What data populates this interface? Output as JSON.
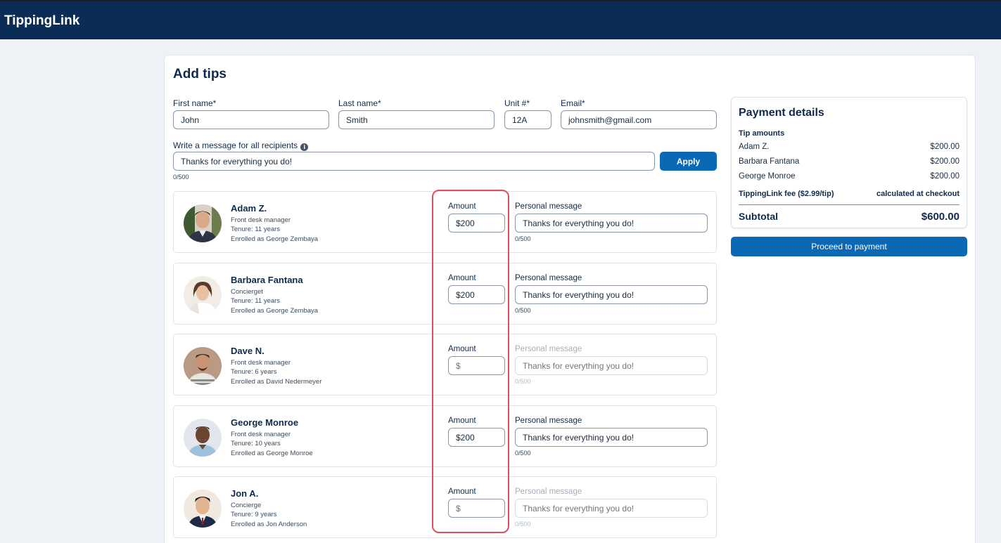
{
  "app": {
    "title": "TippingLink"
  },
  "page": {
    "title": "Add tips"
  },
  "form": {
    "first_name": {
      "label": "First name*",
      "value": "John"
    },
    "last_name": {
      "label": "Last name*",
      "value": "Smith"
    },
    "unit": {
      "label": "Unit #*",
      "value": "12A"
    },
    "email": {
      "label": "Email*",
      "value": "johnsmith@gmail.com"
    },
    "message": {
      "label": "Write a message for all recipients",
      "value": "Thanks for everything you do!",
      "counter": "0/500"
    },
    "apply_label": "Apply"
  },
  "labels": {
    "amount": "Amount",
    "personal_message": "Personal message"
  },
  "recipients": [
    {
      "name": "Adam Z.",
      "role": "Front desk manager",
      "tenure": "Tenure: 11 years",
      "enrolled": "Enrolled as George Zembaya",
      "amount": "$200",
      "message": "Thanks for everything you do!",
      "counter": "0/500"
    },
    {
      "name": "Barbara Fantana",
      "role": "Concierget",
      "tenure": "Tenure: 11 years",
      "enrolled": "Enrolled as George Zembaya",
      "amount": "$200",
      "message": "Thanks for everything you do!",
      "counter": "0/500"
    },
    {
      "name": "Dave N.",
      "role": "Front desk manager",
      "tenure": "Tenure: 6 years",
      "enrolled": "Enrolled as David Nedermeyer",
      "amount": "",
      "amount_placeholder": "$",
      "message": "",
      "message_placeholder": "Thanks for everything you do!",
      "counter": "0/500"
    },
    {
      "name": "George Monroe",
      "role": "Front desk manager",
      "tenure": "Tenure: 10 years",
      "enrolled": "Enrolled as George Monroe",
      "amount": "$200",
      "message": "Thanks for everything you do!",
      "counter": "0/500"
    },
    {
      "name": "Jon A.",
      "role": "Concierge",
      "tenure": "Tenure: 9 years",
      "enrolled": "Enrolled as Jon Anderson",
      "amount": "",
      "amount_placeholder": "$",
      "message": "",
      "message_placeholder": "Thanks for everything you do!",
      "counter": "0/500"
    }
  ],
  "payment": {
    "title": "Payment details",
    "tip_amounts_label": "Tip amounts",
    "lines": [
      {
        "name": "Adam Z.",
        "amount": "$200.00"
      },
      {
        "name": "Barbara Fantana",
        "amount": "$200.00"
      },
      {
        "name": "George Monroe",
        "amount": "$200.00"
      }
    ],
    "fee_label": "TippingLink fee ($2.99/tip)",
    "fee_value": "calculated at checkout",
    "subtotal_label": "Subtotal",
    "subtotal_value": "$600.00",
    "proceed_label": "Proceed to payment"
  },
  "colors": {
    "header": "#0b2d55",
    "accent": "#0b68b5",
    "highlight": "#d9535a"
  }
}
